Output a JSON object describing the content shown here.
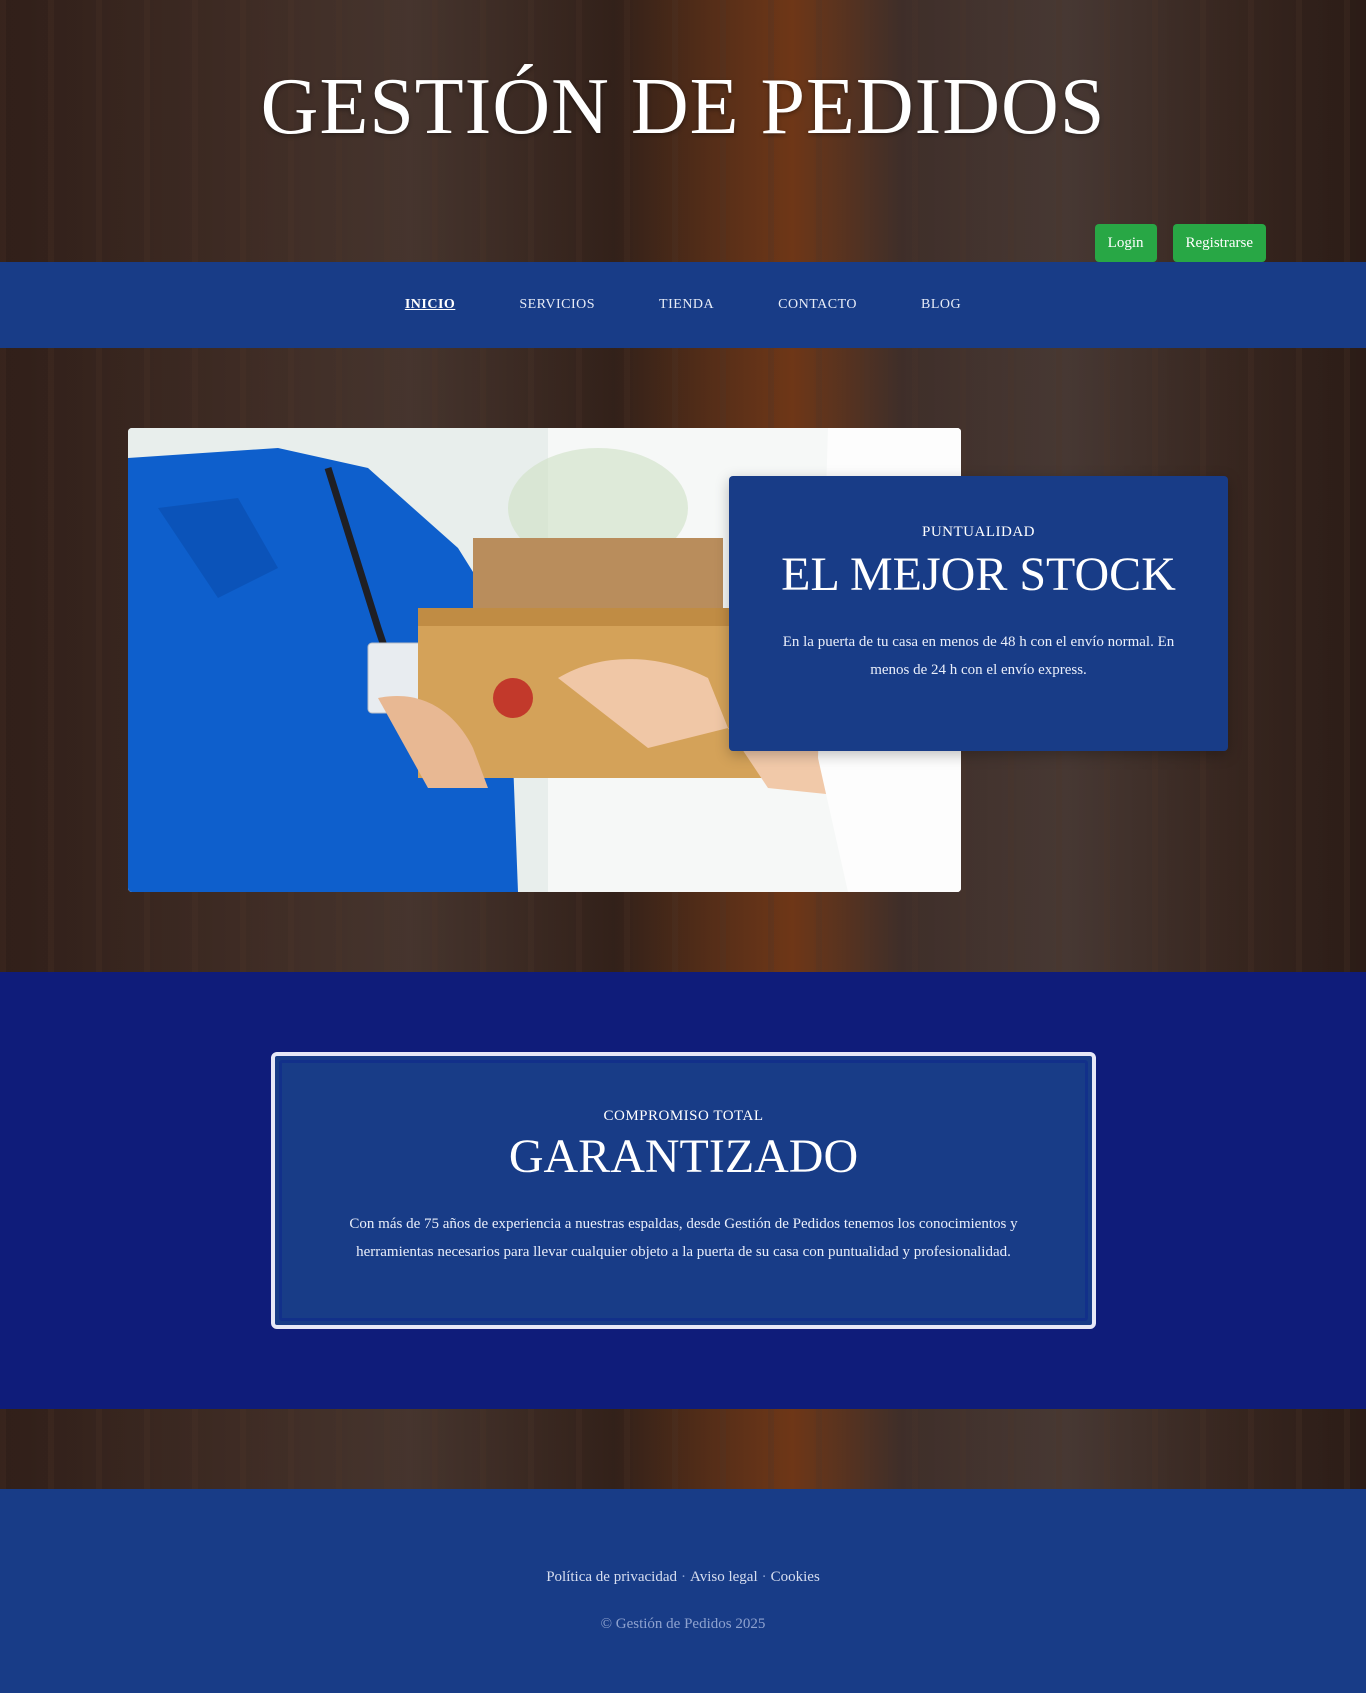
{
  "header": {
    "title": "GESTIÓN DE PEDIDOS",
    "login_label": "Login",
    "register_label": "Registrarse"
  },
  "nav": {
    "items": [
      {
        "label": "INICIO",
        "active": true
      },
      {
        "label": "SERVICIOS"
      },
      {
        "label": "TIENDA"
      },
      {
        "label": "CONTACTO"
      },
      {
        "label": "BLOG"
      }
    ]
  },
  "hero": {
    "image_icon": "delivery-photo",
    "eyebrow": "PUNTUALIDAD",
    "title": "EL MEJOR STOCK",
    "text": "En la puerta de tu casa en menos de 48 h con el envío normal. En menos de 24 h con el envío express."
  },
  "guarantee": {
    "eyebrow": "COMPROMISO TOTAL",
    "title": "GARANTIZADO",
    "text": "Con más de 75 años de experiencia a nuestras espaldas, desde Gestión de Pedidos tenemos los conocimientos y herramientas necesarios para llevar cualquier objeto a la puerta de su casa con puntualidad y profesionalidad."
  },
  "footer": {
    "links": [
      "Política de privacidad",
      "Aviso legal",
      "Cookies"
    ],
    "copyright": "© Gestión de Pedidos 2025"
  },
  "colors": {
    "primary_blue": "#183c87",
    "deep_blue": "#0f1c7a",
    "button_green": "#28a745"
  }
}
